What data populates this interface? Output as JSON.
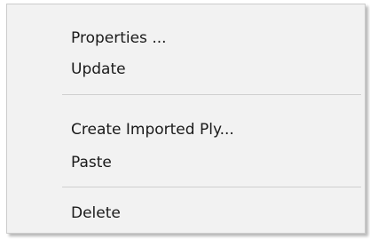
{
  "menu": {
    "items": [
      {
        "label": "Properties ..."
      },
      {
        "label": "Update"
      },
      {
        "label": "Create Imported Ply..."
      },
      {
        "label": "Paste"
      },
      {
        "label": "Delete"
      }
    ]
  }
}
